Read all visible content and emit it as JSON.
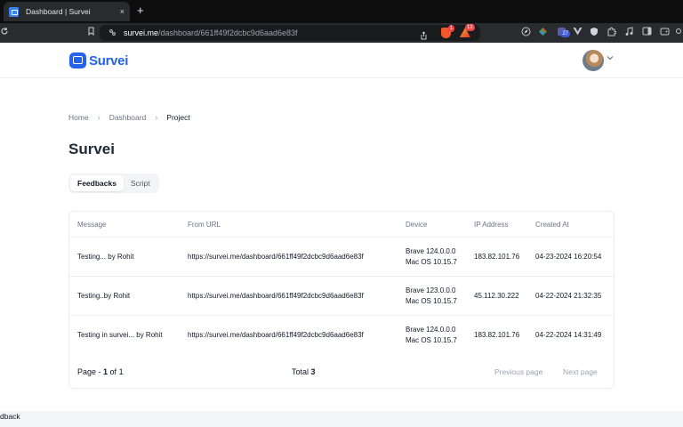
{
  "browser": {
    "tab_title": "Dashboard | Survei",
    "tab_close": "×",
    "new_tab": "+",
    "url_domain": "survei.me",
    "url_path": "/dashboard/661ff49f2dcbc9d6aad6e83f",
    "extension_badge_1": "1",
    "extension_badge_2": "12",
    "extension_badge_3": "27"
  },
  "app": {
    "logo_text": "Survei",
    "brand_color": "#2563eb"
  },
  "breadcrumb": {
    "items": [
      "Home",
      "Dashboard",
      "Project"
    ],
    "separator": "›"
  },
  "page": {
    "title": "Survei",
    "tabs": [
      {
        "label": "Feedbacks",
        "active": true
      },
      {
        "label": "Script",
        "active": false
      }
    ]
  },
  "table": {
    "headers": [
      "Message",
      "From URL",
      "Device",
      "IP Address",
      "Created At"
    ],
    "rows": [
      {
        "message": "Testing... by Rohit",
        "url": "https://survei.me/dashboard/661ff49f2dcbc9d6aad6e83f",
        "device_line1": "Brave 124.0.0.0",
        "device_line2": "Mac OS 10.15.7",
        "ip": "183.82.101.76",
        "created": "04-23-2024 16:20:54"
      },
      {
        "message": "Testing..by Rohit",
        "url": "https://survei.me/dashboard/661ff49f2dcbc9d6aad6e83f",
        "device_line1": "Brave 123.0.0.0",
        "device_line2": "Mac OS 10.15.7",
        "ip": "45.112.30.222",
        "created": "04-22-2024 21:32:35"
      },
      {
        "message": "Testing in survei... by Rohit",
        "url": "https://survei.me/dashboard/661ff49f2dcbc9d6aad6e83f",
        "device_line1": "Brave 124.0.0.0",
        "device_line2": "Mac OS 10.15.7",
        "ip": "183.82.101.76",
        "created": "04-22-2024 14:31:49"
      }
    ]
  },
  "pagination": {
    "page_label": "Page - ",
    "current": "1",
    "of_label": " of ",
    "total_pages": "1",
    "total_label": "Total ",
    "total_count": "3",
    "previous": "Previous page",
    "next": "Next page"
  },
  "feedback_widget": {
    "label": "dback"
  }
}
